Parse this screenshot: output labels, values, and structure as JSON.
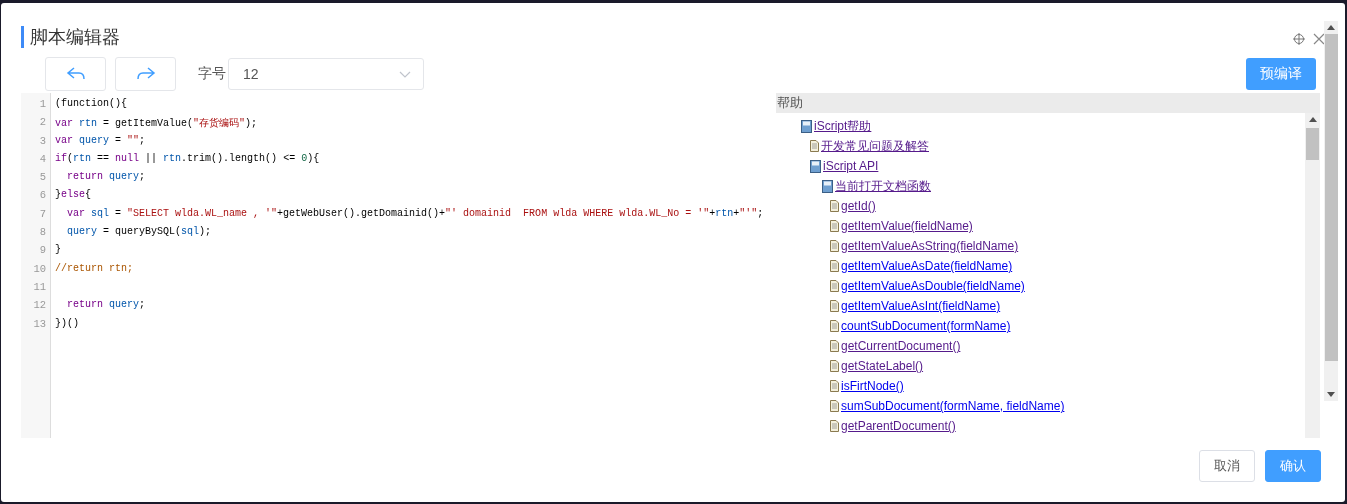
{
  "dialog": {
    "title": "脚本编辑器"
  },
  "toolbar": {
    "font_size_label": "字号",
    "font_size": "12",
    "precompile": "预编译"
  },
  "editor": {
    "lines": [
      {
        "number": "1",
        "tokens": [
          {
            "kind": "plain",
            "text": "(function(){"
          }
        ]
      },
      {
        "number": "2",
        "tokens": [
          {
            "kind": "keyword",
            "text": "var"
          },
          {
            "kind": "variable",
            "text": " rtn"
          },
          {
            "kind": "plain",
            "text": " = getItemValue("
          },
          {
            "kind": "string",
            "text": "\"存货编码\""
          },
          {
            "kind": "plain",
            "text": ");"
          }
        ]
      },
      {
        "number": "3",
        "tokens": [
          {
            "kind": "keyword",
            "text": "var"
          },
          {
            "kind": "variable",
            "text": " query"
          },
          {
            "kind": "plain",
            "text": " = "
          },
          {
            "kind": "string",
            "text": "\"\""
          },
          {
            "kind": "plain",
            "text": ";"
          }
        ]
      },
      {
        "number": "4",
        "tokens": [
          {
            "kind": "keyword",
            "text": "if"
          },
          {
            "kind": "plain",
            "text": "("
          },
          {
            "kind": "variable",
            "text": "rtn"
          },
          {
            "kind": "plain",
            "text": " == "
          },
          {
            "kind": "keyword",
            "text": "null"
          },
          {
            "kind": "plain",
            "text": " || "
          },
          {
            "kind": "variable",
            "text": "rtn"
          },
          {
            "kind": "plain",
            "text": ".trim().length() <= "
          },
          {
            "kind": "number",
            "text": "0"
          },
          {
            "kind": "plain",
            "text": "){"
          }
        ]
      },
      {
        "number": "5",
        "tokens": [
          {
            "kind": "keyword",
            "text": "  return"
          },
          {
            "kind": "variable",
            "text": " query"
          },
          {
            "kind": "plain",
            "text": ";"
          }
        ]
      },
      {
        "number": "6",
        "tokens": [
          {
            "kind": "plain",
            "text": "}"
          },
          {
            "kind": "keyword",
            "text": "else"
          },
          {
            "kind": "plain",
            "text": "{"
          }
        ]
      },
      {
        "number": "7",
        "tokens": [
          {
            "kind": "keyword",
            "text": "  var"
          },
          {
            "kind": "variable",
            "text": " sql"
          },
          {
            "kind": "plain",
            "text": " = "
          },
          {
            "kind": "string",
            "text": "\"SELECT wlda.WL_name , '\""
          },
          {
            "kind": "plain",
            "text": "+getWebUser().getDomainid()+"
          },
          {
            "kind": "string",
            "text": "\"' domainid  FROM wlda WHERE wlda.WL_No = '\""
          },
          {
            "kind": "plain",
            "text": "+"
          },
          {
            "kind": "variable",
            "text": "rtn"
          },
          {
            "kind": "plain",
            "text": "+"
          },
          {
            "kind": "string",
            "text": "\"'\""
          },
          {
            "kind": "plain",
            "text": ";"
          }
        ]
      },
      {
        "number": "8",
        "tokens": [
          {
            "kind": "variable",
            "text": "  query"
          },
          {
            "kind": "plain",
            "text": " = queryBySQL("
          },
          {
            "kind": "variable",
            "text": "sql"
          },
          {
            "kind": "plain",
            "text": ");"
          }
        ]
      },
      {
        "number": "9",
        "tokens": [
          {
            "kind": "plain",
            "text": "}"
          }
        ]
      },
      {
        "number": "10",
        "tokens": [
          {
            "kind": "comment",
            "text": "//return rtn;"
          }
        ]
      },
      {
        "number": "11"
      },
      {
        "number": "12",
        "tokens": [
          {
            "kind": "keyword",
            "text": "  return"
          },
          {
            "kind": "variable",
            "text": " query"
          },
          {
            "kind": "plain",
            "text": ";"
          }
        ]
      },
      {
        "number": "13",
        "tokens": [
          {
            "kind": "plain",
            "text": "})()"
          }
        ]
      }
    ]
  },
  "help": {
    "title": "帮助",
    "tree": [
      {
        "kind": "book",
        "label": "iScript帮助",
        "visited": true,
        "children": [
          {
            "kind": "page",
            "label": "开发常见问题及解答",
            "visited": true
          },
          {
            "kind": "book",
            "label": "iScript API",
            "visited": true,
            "children": [
              {
                "kind": "book",
                "label": "当前打开文档函数",
                "visited": true,
                "children": [
                  {
                    "kind": "page",
                    "label": "getId()",
                    "visited": true
                  },
                  {
                    "kind": "page",
                    "label": "getItemValue(fieldName)",
                    "visited": true
                  },
                  {
                    "kind": "page",
                    "label": "getItemValueAsString(fieldName)",
                    "visited": true
                  },
                  {
                    "kind": "page",
                    "label": "getItemValueAsDate(fieldName)",
                    "visited": false
                  },
                  {
                    "kind": "page",
                    "label": "getItemValueAsDouble(fieldName)",
                    "visited": false
                  },
                  {
                    "kind": "page",
                    "label": "getItemValueAsInt(fieldName)",
                    "visited": false
                  },
                  {
                    "kind": "page",
                    "label": "countSubDocument(formName)",
                    "visited": false
                  },
                  {
                    "kind": "page",
                    "label": "getCurrentDocument()",
                    "visited": true
                  },
                  {
                    "kind": "page",
                    "label": "getStateLabel()",
                    "visited": true
                  },
                  {
                    "kind": "page",
                    "label": "isFirtNode()",
                    "visited": false
                  },
                  {
                    "kind": "page",
                    "label": "sumSubDocument(formName, fieldName)",
                    "visited": false
                  },
                  {
                    "kind": "page",
                    "label": "getParentDocument()",
                    "visited": true
                  }
                ]
              }
            ]
          }
        ]
      }
    ]
  },
  "footer": {
    "buttons": [
      {
        "label": "取消",
        "primary": false
      },
      {
        "label": "确认",
        "primary": true
      }
    ]
  }
}
